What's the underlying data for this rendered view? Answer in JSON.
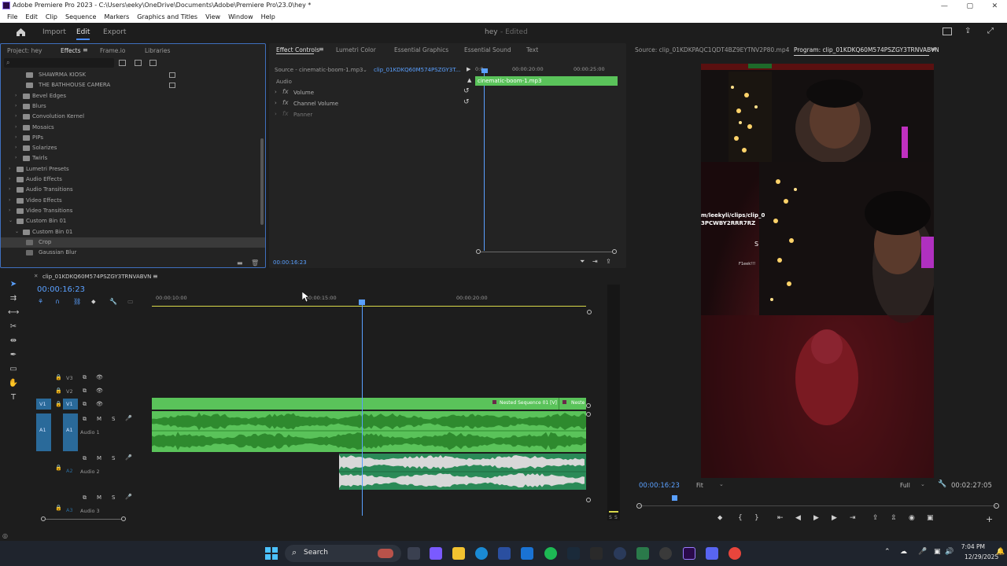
{
  "window": {
    "title": "Adobe Premiere Pro 2023 - C:\\Users\\eeky\\OneDrive\\Documents\\Adobe\\Premiere Pro\\23.0\\hey *",
    "controls": [
      "—",
      "▢",
      "✕"
    ]
  },
  "menu": [
    "File",
    "Edit",
    "Clip",
    "Sequence",
    "Markers",
    "Graphics and Titles",
    "View",
    "Window",
    "Help"
  ],
  "workspace": {
    "tabs": [
      "Import",
      "Edit",
      "Export"
    ],
    "active_tab": "Edit",
    "project_name": "hey",
    "project_status": "- Edited"
  },
  "left_panel": {
    "tabs": [
      "Project: hey",
      "Effects",
      "Frame.io",
      "Libraries"
    ],
    "active_tab": "Effects",
    "tree": [
      {
        "label": "SHAWRMA KIOSK",
        "depth": 2,
        "type": "item"
      },
      {
        "label": "THE BATHHOUSE CAMERA",
        "depth": 2,
        "type": "item"
      },
      {
        "label": "Bevel Edges",
        "depth": 1,
        "type": "folder"
      },
      {
        "label": "Blurs",
        "depth": 1,
        "type": "folder"
      },
      {
        "label": "Convolution Kernel",
        "depth": 1,
        "type": "folder"
      },
      {
        "label": "Mosaics",
        "depth": 1,
        "type": "folder"
      },
      {
        "label": "PIPs",
        "depth": 1,
        "type": "folder"
      },
      {
        "label": "Solarizes",
        "depth": 1,
        "type": "folder"
      },
      {
        "label": "Twirls",
        "depth": 1,
        "type": "folder"
      },
      {
        "label": "Lumetri Presets",
        "depth": 0,
        "type": "folder"
      },
      {
        "label": "Audio Effects",
        "depth": 0,
        "type": "folder"
      },
      {
        "label": "Audio Transitions",
        "depth": 0,
        "type": "folder"
      },
      {
        "label": "Video Effects",
        "depth": 0,
        "type": "folder"
      },
      {
        "label": "Video Transitions",
        "depth": 0,
        "type": "folder"
      },
      {
        "label": "Custom Bin 01",
        "depth": 0,
        "type": "folder-open"
      },
      {
        "label": "Custom Bin 01",
        "depth": 1,
        "type": "folder-open"
      },
      {
        "label": "Crop",
        "depth": 2,
        "type": "effect",
        "selected": true
      },
      {
        "label": "Gaussian Blur",
        "depth": 2,
        "type": "effect"
      }
    ]
  },
  "effect_controls": {
    "tabs": [
      "Effect Controls",
      "Lumetri Color",
      "Essential Graphics",
      "Essential Sound",
      "Text"
    ],
    "active_tab": "Effect Controls",
    "source": "Source - cinematic-boom-1.mp3",
    "sequence": "clip_01KDKQ60M574PSZGY3T...",
    "section": "Audio",
    "properties": [
      "Volume",
      "Channel Volume",
      "Panner"
    ],
    "ruler": [
      "00:00:20:00",
      "00:00:25:00"
    ],
    "ruler_start": "0:0",
    "clip_label": "cinematic-boom-1.mp3",
    "timecode": "00:00:16:23"
  },
  "monitors": {
    "source_tab": "Source: clip_01KDKPAQC1QDT4BZ9EYTNV2P80.mp4",
    "program_tab": "Program: clip_01KDKQ60M574PSZGY3TRNVABVN",
    "overlay_text": "m/leekyli/clips/clip_0\n3PCWBY2RRR7RZ",
    "overlay_s": "S",
    "overlay_small": "F1eek!!!",
    "timecode": "00:00:16:23",
    "fit": "Fit",
    "quality": "Full",
    "duration": "00:02:27:05"
  },
  "timeline": {
    "sequence_name": "clip_01KDKQ60M574PSZGY3TRNVABVN",
    "timecode": "00:00:16:23",
    "ruler": [
      "00:00:10:00",
      "00:00:15:00",
      "00:00:20:00"
    ],
    "video_tracks": [
      "V3",
      "V2",
      "V1"
    ],
    "audio_tracks": [
      {
        "id": "A1",
        "name": "Audio 1"
      },
      {
        "id": "A2",
        "name": "Audio 2"
      },
      {
        "id": "A3",
        "name": "Audio 3"
      }
    ],
    "clip_labels": [
      "Nested Sequence 01 [V]",
      "Neste"
    ],
    "track_buttons": [
      "M",
      "S"
    ],
    "meter_labels": [
      "S",
      "S"
    ]
  },
  "taskbar": {
    "search_label": "Search",
    "time": "7:04 PM",
    "date": "12/29/2025"
  },
  "colors": {
    "accent": "#4a8cff",
    "clip_green": "#5ac35a",
    "audio_dark_green": "#2a8a57",
    "playhead": "#5aa0ff"
  }
}
